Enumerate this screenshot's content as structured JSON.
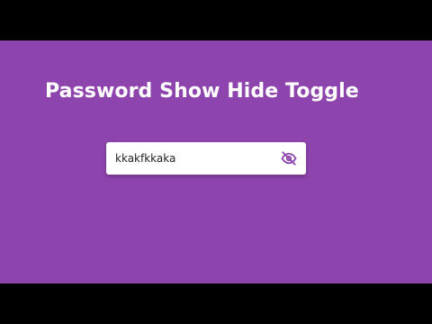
{
  "title": "Password Show Hide Toggle",
  "password_field": {
    "value": "kkakfkkaka",
    "type": "text"
  },
  "toggle_icon": "eye-off-icon",
  "colors": {
    "background": "#8e44ad",
    "letterbox": "#000000",
    "icon": "#8e44ad",
    "title": "#ffffff"
  }
}
